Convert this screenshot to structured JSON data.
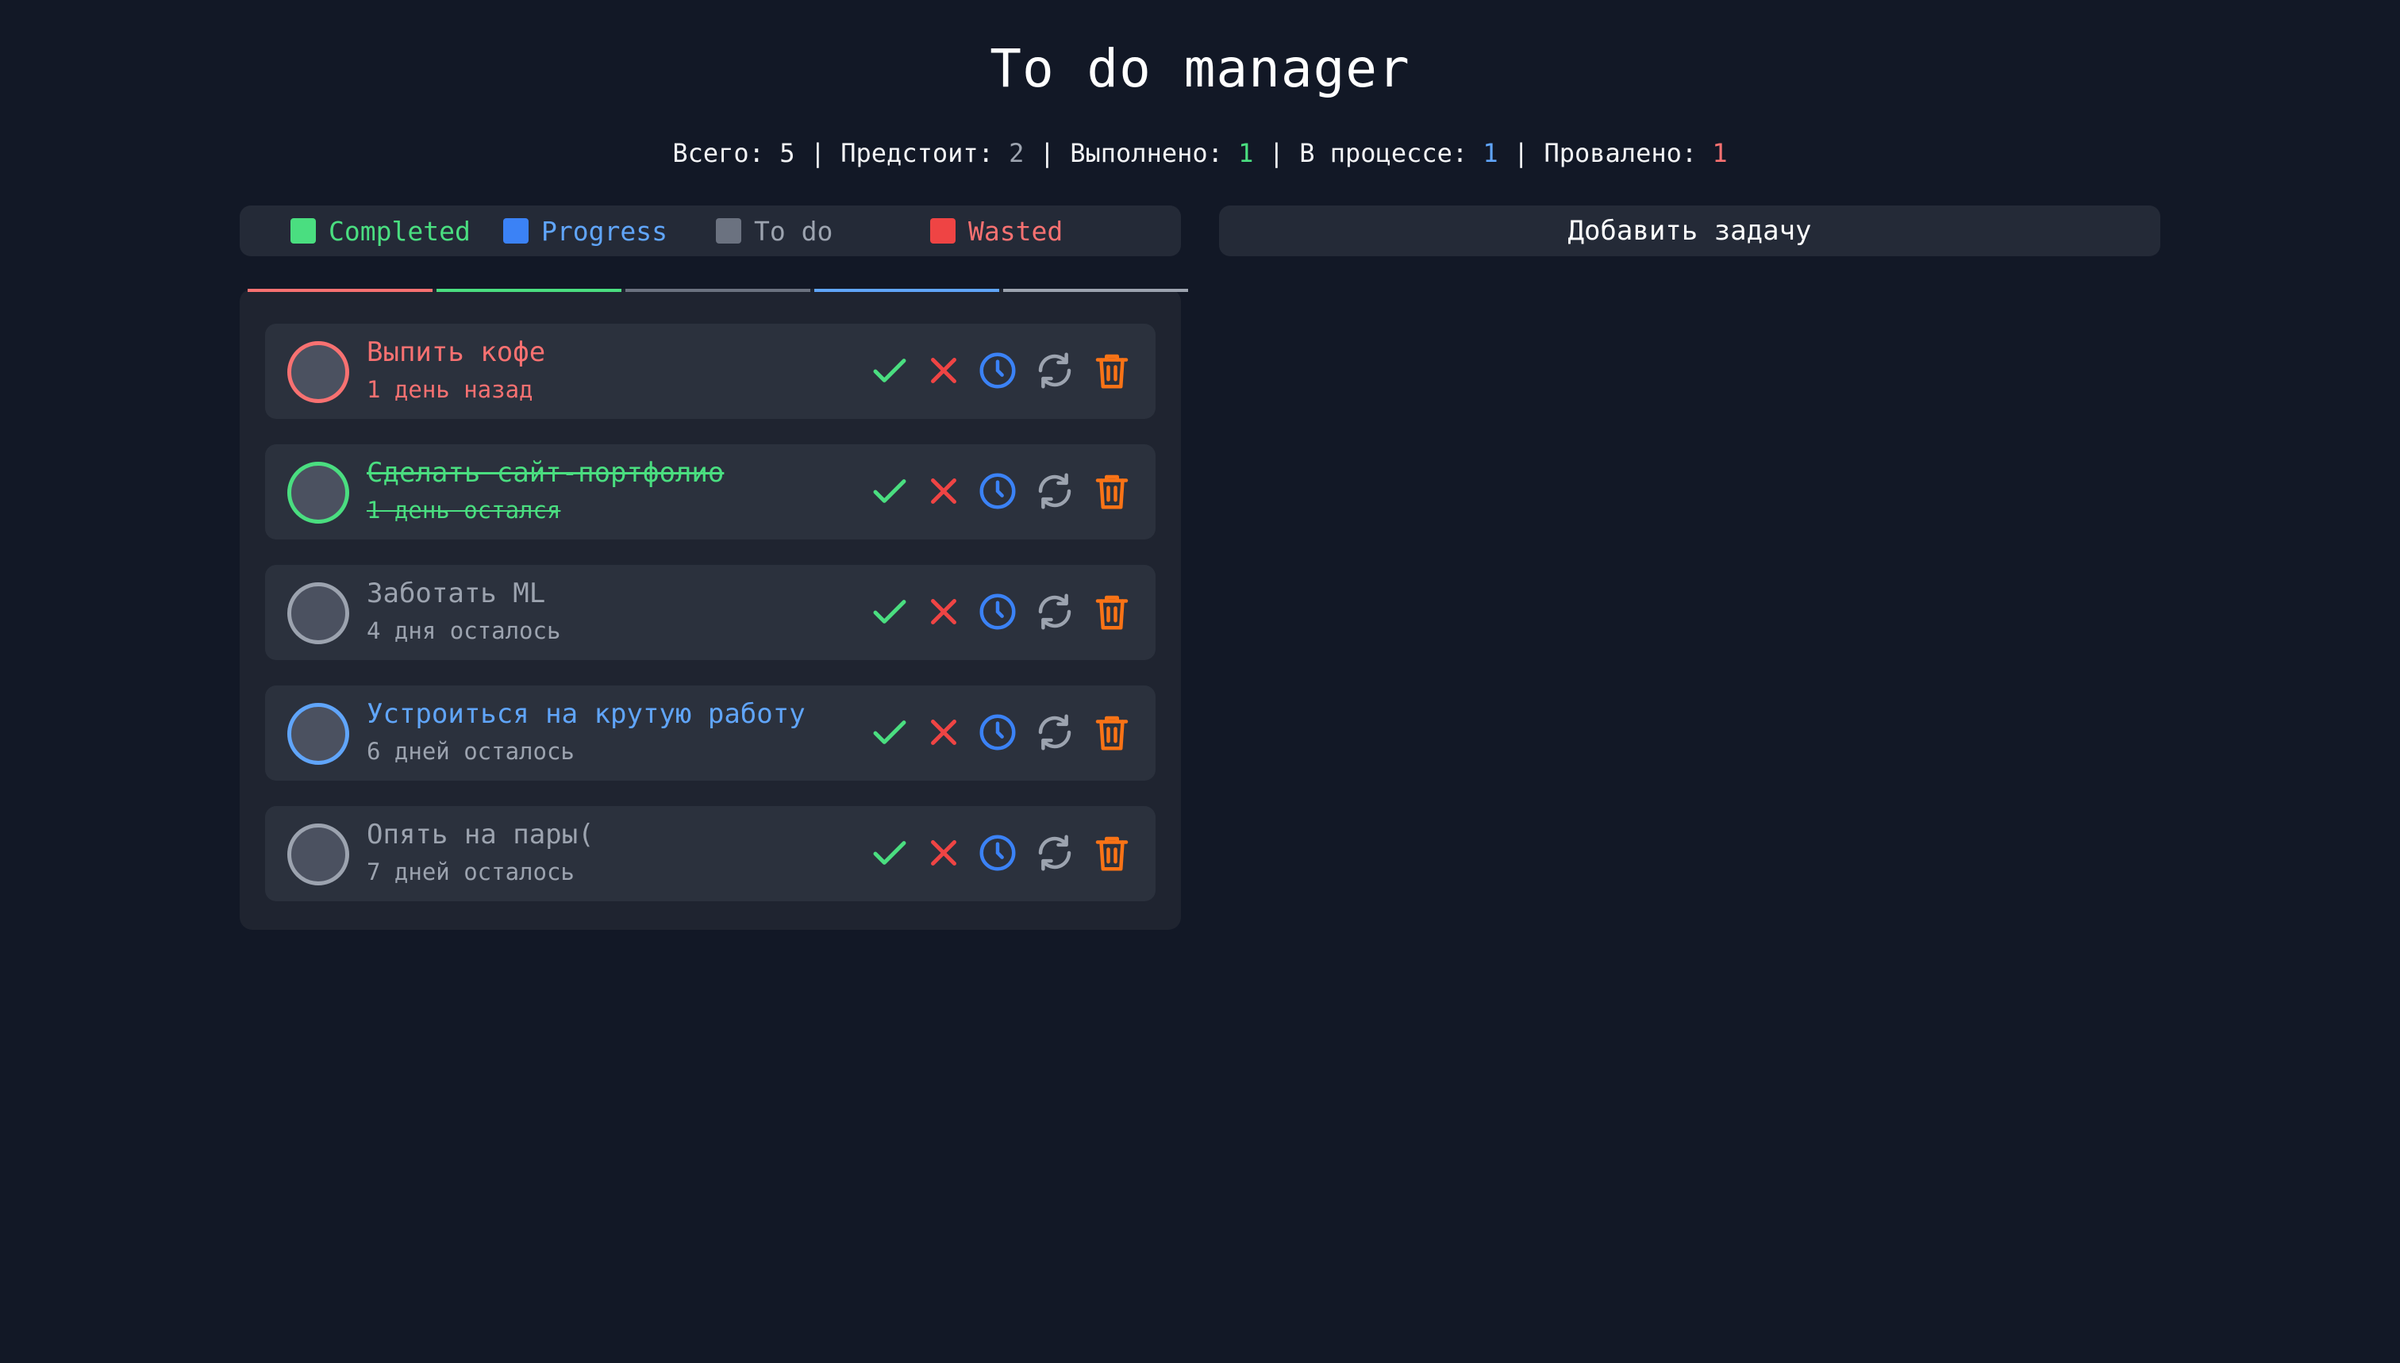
{
  "app": {
    "title": "To do manager"
  },
  "stats": {
    "total_label": "Всего:",
    "total_value": "5",
    "upcoming_label": "Предстоит:",
    "upcoming_value": "2",
    "done_label": "Выполнено:",
    "done_value": "1",
    "progress_label": "В процессе:",
    "progress_value": "1",
    "failed_label": "Провалено:",
    "failed_value": "1",
    "separator": "|"
  },
  "legend": [
    {
      "label": "Completed",
      "color": "#4ade80",
      "swatch": "#4ade80"
    },
    {
      "label": "Progress",
      "color": "#60a5fa",
      "swatch": "#3b82f6"
    },
    {
      "label": "To do",
      "color": "#9ca3af",
      "swatch": "#6b7280"
    },
    {
      "label": "Wasted",
      "color": "#f87171",
      "swatch": "#ef4444"
    }
  ],
  "add_button": {
    "label": "Добавить задачу"
  },
  "progress_segments": [
    "#f87171",
    "#4ade80",
    "#6b7280",
    "#60a5fa",
    "#9ca3af"
  ],
  "tasks": [
    {
      "title": "Выпить кофе",
      "subtitle": "1 день назад",
      "status": "wasted",
      "color": "#f87171",
      "sub_color": "#f87171"
    },
    {
      "title": "Сделать сайт-портфолио",
      "subtitle": "1 день остался",
      "status": "completed",
      "color": "#4ade80",
      "sub_color": "#4ade80"
    },
    {
      "title": "Заботать ML",
      "subtitle": "4 дня осталось",
      "status": "todo",
      "color": "#9ca3af",
      "sub_color": "#9ca3af"
    },
    {
      "title": "Устроиться на крутую работу",
      "subtitle": "6 дней осталось",
      "status": "progress",
      "color": "#60a5fa",
      "sub_color": "#9ca3af"
    },
    {
      "title": "Опять на пары(",
      "subtitle": "7 дней осталось",
      "status": "todo",
      "color": "#9ca3af",
      "sub_color": "#9ca3af"
    }
  ],
  "action_icons": [
    {
      "name": "check-icon",
      "color": "#4ade80"
    },
    {
      "name": "x-icon",
      "color": "#ef4444"
    },
    {
      "name": "clock-icon",
      "color": "#3b82f6"
    },
    {
      "name": "refresh-icon",
      "color": "#9ca3af"
    },
    {
      "name": "trash-icon",
      "color": "#f97316"
    }
  ]
}
